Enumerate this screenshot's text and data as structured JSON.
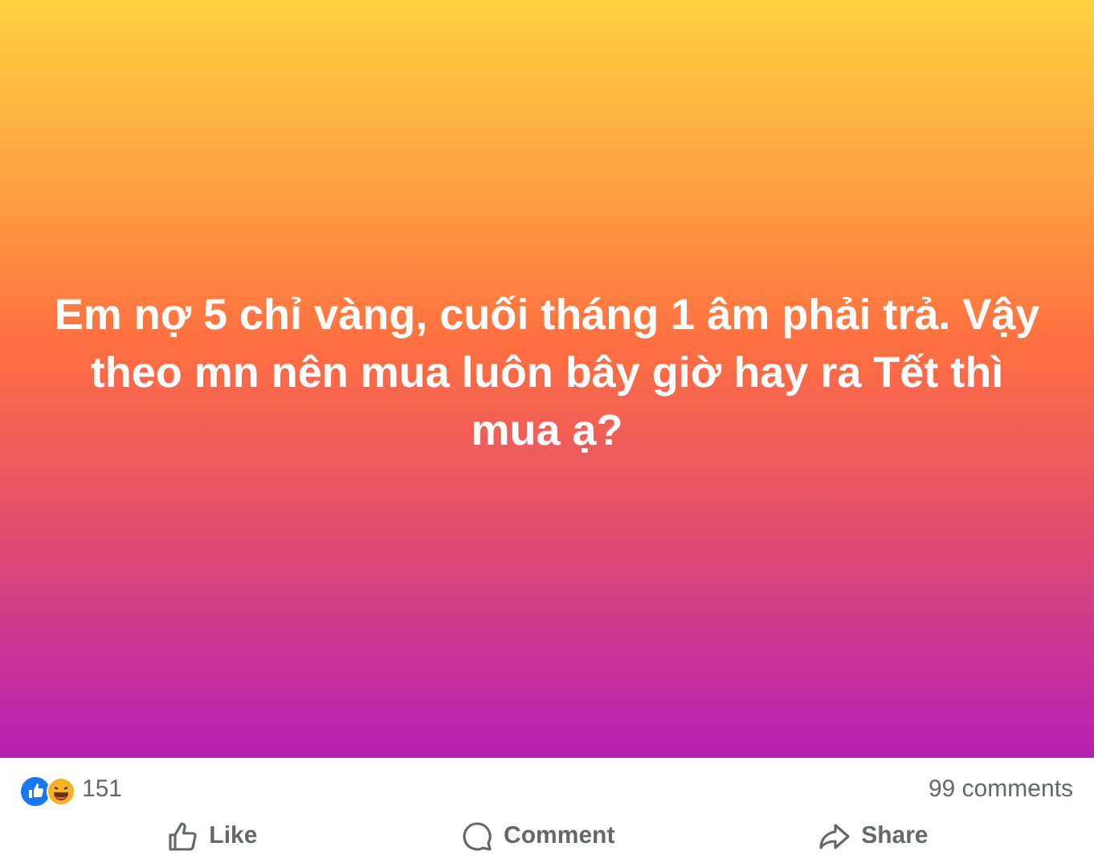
{
  "post": {
    "text": "Em nợ 5 chỉ vàng, cuối tháng 1 âm phải trả. Vậy theo mn nên mua luôn bây giờ hay ra Tết thì mua ạ?"
  },
  "reactions": {
    "count": "151",
    "comments": "99 comments"
  },
  "actions": [
    {
      "kind": "like",
      "label": "Like"
    },
    {
      "kind": "comment",
      "label": "Comment"
    },
    {
      "kind": "share",
      "label": "Share"
    }
  ]
}
